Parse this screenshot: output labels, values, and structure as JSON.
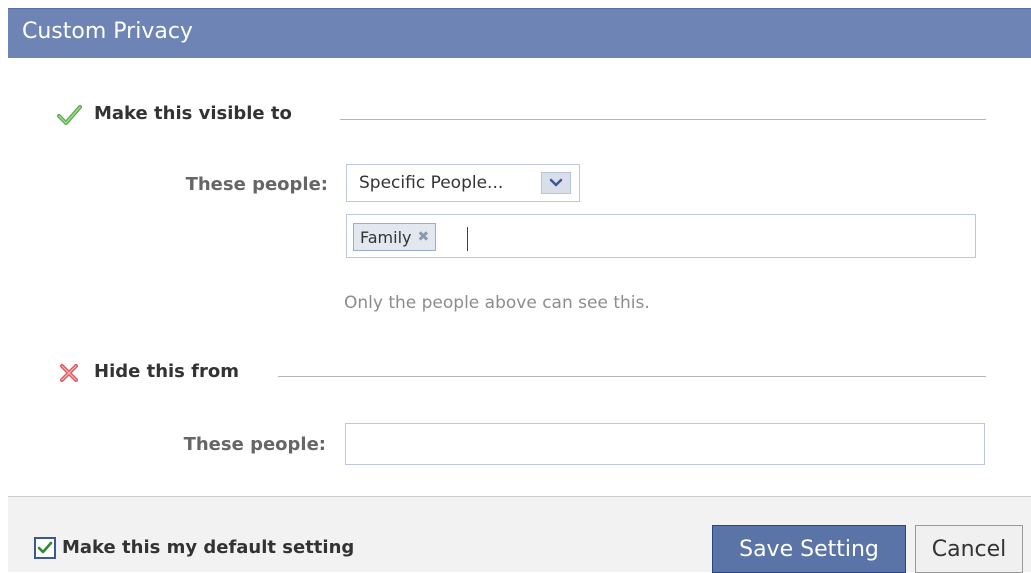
{
  "dialog": {
    "title": "Custom Privacy"
  },
  "visible_section": {
    "heading": "Make this visible to",
    "icon": "check-icon",
    "field_label": "These people:",
    "select_value": "Specific People...",
    "tokens": [
      "Family"
    ],
    "hint": "Only the people above can see this."
  },
  "hide_section": {
    "heading": "Hide this from",
    "icon": "x-icon",
    "field_label": "These people:",
    "input_value": ""
  },
  "footer": {
    "default_checkbox_label": "Make this my default setting",
    "default_checked": true,
    "save_label": "Save Setting",
    "cancel_label": "Cancel"
  },
  "colors": {
    "header": "#6d84b4",
    "primary_button": "#5b74a8",
    "check_green": "#5aab4c",
    "x_red": "#d9575c"
  }
}
